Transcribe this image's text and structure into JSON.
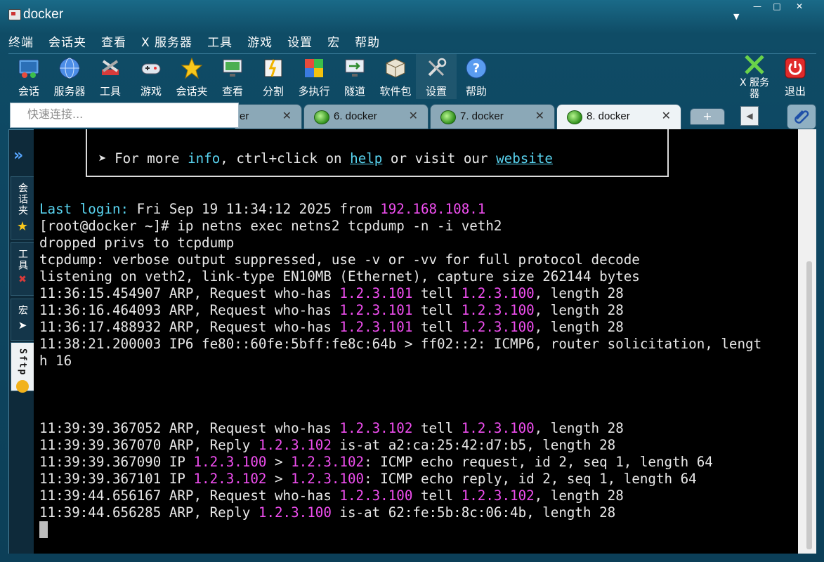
{
  "window": {
    "title": "docker"
  },
  "menu": [
    "终端",
    "会话夹",
    "查看",
    "X 服务器",
    "工具",
    "游戏",
    "设置",
    "宏",
    "帮助"
  ],
  "toolbar": {
    "items": [
      {
        "label": "会话",
        "icon": "session-icon"
      },
      {
        "label": "服务器",
        "icon": "servers-globe-icon"
      },
      {
        "label": "工具",
        "icon": "tools-icon"
      },
      {
        "label": "游戏",
        "icon": "gamepad-icon"
      },
      {
        "label": "会话夹",
        "icon": "star-icon"
      },
      {
        "label": "查看",
        "icon": "monitor-view-icon"
      },
      {
        "label": "分割",
        "icon": "split-icon"
      },
      {
        "label": "多执行",
        "icon": "multiexec-icon"
      },
      {
        "label": "隧道",
        "icon": "tunnel-icon"
      },
      {
        "label": "软件包",
        "icon": "packages-icon"
      },
      {
        "label": "设置",
        "icon": "settings-tools-icon"
      },
      {
        "label": "帮助",
        "icon": "help-icon"
      }
    ],
    "xserver_label": "X 服务器",
    "exit_label": "退出"
  },
  "quick_connect_placeholder": "快速连接...",
  "tabs": {
    "partial_label": "er",
    "items": [
      "6. docker",
      "7. docker",
      "8. docker"
    ],
    "active_index": 2,
    "add": "+"
  },
  "sidebar": {
    "expand": "»",
    "items": [
      "会话夹",
      "工具",
      "宏",
      "Sftp"
    ],
    "active": "Sftp"
  },
  "terminal": {
    "info_prefix": "➤ For more ",
    "info_link1": "info",
    "info_mid1": ", ctrl+click on ",
    "info_link2": "help",
    "info_mid2": " or visit our ",
    "info_link3": "website",
    "login_label": "Last login:",
    "login_rest": " Fri Sep 19 11:34:12 2025 from ",
    "login_ip": "192.168.108.1",
    "prompt_cmd": "[root@docker ~]# ip netns exec netns2 tcpdump -n -i veth2",
    "l1": "dropped privs to tcpdump",
    "l2": "tcpdump: verbose output suppressed, use -v or -vv for full protocol decode",
    "l3": "listening on veth2, link-type EN10MB (Ethernet), capture size 262144 bytes",
    "arp1": {
      "t": "11:36:15.454907 ARP, Request who-has ",
      "a": "1.2.3.101",
      "m": " tell ",
      "b": "1.2.3.100",
      "e": ", length 28"
    },
    "arp2": {
      "t": "11:36:16.464093 ARP, Request who-has ",
      "a": "1.2.3.101",
      "m": " tell ",
      "b": "1.2.3.100",
      "e": ", length 28"
    },
    "arp3": {
      "t": "11:36:17.488932 ARP, Request who-has ",
      "a": "1.2.3.101",
      "m": " tell ",
      "b": "1.2.3.100",
      "e": ", length 28"
    },
    "ip6a": "11:38:21.200003 IP6 fe80::60fe:5bff:fe8c:64b > ff02::2: ICMP6, router solicitation, lengt",
    "ip6b": "h 16",
    "r1": {
      "t": "11:39:39.367052 ARP, Request who-has ",
      "a": "1.2.3.102",
      "m": " tell ",
      "b": "1.2.3.100",
      "e": ", length 28"
    },
    "r2": {
      "t": "11:39:39.367070 ARP, Reply ",
      "a": "1.2.3.102",
      "e": " is-at a2:ca:25:42:d7:b5, length 28"
    },
    "r3": {
      "t": "11:39:39.367090 IP ",
      "a": "1.2.3.100",
      "m": " > ",
      "b": "1.2.3.102",
      "e": ": ICMP echo request, id 2, seq 1, length 64"
    },
    "r4": {
      "t": "11:39:39.367101 IP ",
      "a": "1.2.3.102",
      "m": " > ",
      "b": "1.2.3.100",
      "e": ": ICMP echo reply, id 2, seq 1, length 64"
    },
    "r5": {
      "t": "11:39:44.656167 ARP, Request who-has ",
      "a": "1.2.3.100",
      "m": " tell ",
      "b": "1.2.3.102",
      "e": ", length 28"
    },
    "r6": {
      "t": "11:39:44.656285 ARP, Reply ",
      "a": "1.2.3.100",
      "e": " is-at 62:fe:5b:8c:06:4b, length 28"
    }
  },
  "colors": {
    "terminal_bg": "#000000",
    "text": "#e8e8e8",
    "cyan": "#59d4f0",
    "magenta": "#f04ef0",
    "frame": "#0f4c66"
  }
}
